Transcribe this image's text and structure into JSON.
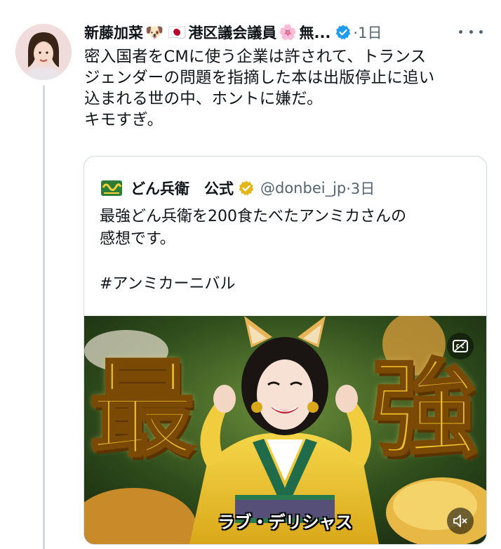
{
  "tweet": {
    "author_name": "新藤加菜",
    "author_badges": [
      "🐶",
      "🇯🇵"
    ],
    "author_title": "港区議会議員",
    "author_badge_after": "🌸",
    "author_truncated": "無...",
    "time": "·1日",
    "text": "密入国者をCMに使う企業は許されて、トランス\nジェンダーの問題を指摘した本は出版停止に追い\n込まれる世の中、ホントに嫌だ。\nキモすぎ。"
  },
  "quote": {
    "author_name": "どん兵衛　公式",
    "handle": "@donbei_jp",
    "time": "·3日",
    "text": "最強どん兵衛を200食たべたアンミカさんの\n感想です。\n\n#アンミカーニバル",
    "media": {
      "big_left": "最",
      "big_right": "強",
      "caption": "ラブ・デリシャス"
    }
  },
  "colors": {
    "verified_blue": "#1d9bf0",
    "verified_gold": "#e2b719",
    "secondary_text": "#536471",
    "border": "#cfd9de"
  },
  "icons": {
    "verified": "verified-badge-icon",
    "more": "more-icon",
    "captions": "closed-captions-icon",
    "mute": "volume-muted-icon"
  }
}
